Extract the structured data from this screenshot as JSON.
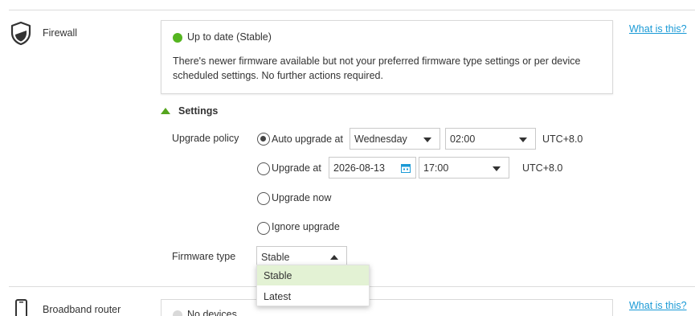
{
  "firewall": {
    "title": "Firewall",
    "help_link": "What is this?",
    "status": {
      "text": "Up to date (Stable)",
      "color": "#55b520",
      "description": "There's newer firmware available but not your preferred firmware type settings or per device scheduled settings. No further actions required."
    },
    "settings": {
      "toggle_label": "Settings",
      "upgrade_policy_label": "Upgrade policy",
      "options": [
        {
          "label": "Auto upgrade at",
          "checked": true,
          "day": "Wednesday",
          "time": "02:00",
          "tz": "UTC+8.0"
        },
        {
          "label": "Upgrade at",
          "checked": false,
          "date": "2026-08-13",
          "time": "17:00",
          "tz": "UTC+8.0"
        },
        {
          "label": "Upgrade now",
          "checked": false
        },
        {
          "label": "Ignore upgrade",
          "checked": false
        }
      ],
      "firmware_type_label": "Firmware type",
      "firmware_type_value": "Stable",
      "firmware_type_options": [
        "Stable",
        "Latest"
      ]
    }
  },
  "broadband": {
    "title": "Broadband router",
    "help_link": "What is this?",
    "status_text": "No devices"
  },
  "colors": {
    "accent_green": "#55b520",
    "link_blue": "#1a9ad6",
    "selected_option_bg": "#e3f2d4"
  }
}
